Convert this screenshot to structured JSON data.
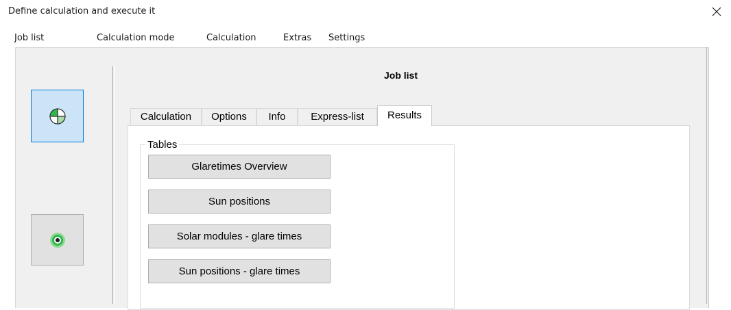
{
  "window": {
    "title": "Define calculation and execute it"
  },
  "menubar": {
    "items": [
      "Job list",
      "Calculation mode",
      "Calculation",
      "Extras",
      "Settings"
    ]
  },
  "sidebar": {
    "buttons": [
      {
        "icon": "quadrant-circle-icon",
        "state": "active"
      },
      {
        "icon": "target-dot-icon",
        "state": "normal"
      }
    ]
  },
  "panel": {
    "title": "Job list"
  },
  "tabs": [
    {
      "label": "Calculation",
      "selected": false
    },
    {
      "label": "Options",
      "selected": false
    },
    {
      "label": "Info",
      "selected": false
    },
    {
      "label": "Express-list",
      "selected": false
    },
    {
      "label": "Results",
      "selected": true
    }
  ],
  "tables_group": {
    "label": "Tables",
    "buttons": [
      "Glaretimes Overview",
      "Sun positions",
      "Solar modules - glare times",
      "Sun positions - glare times"
    ]
  },
  "colors": {
    "active_bg": "#cce4f7",
    "active_border": "#0078d7",
    "icon_green": "#2db84f",
    "icon_light_green": "#a8dba8"
  }
}
